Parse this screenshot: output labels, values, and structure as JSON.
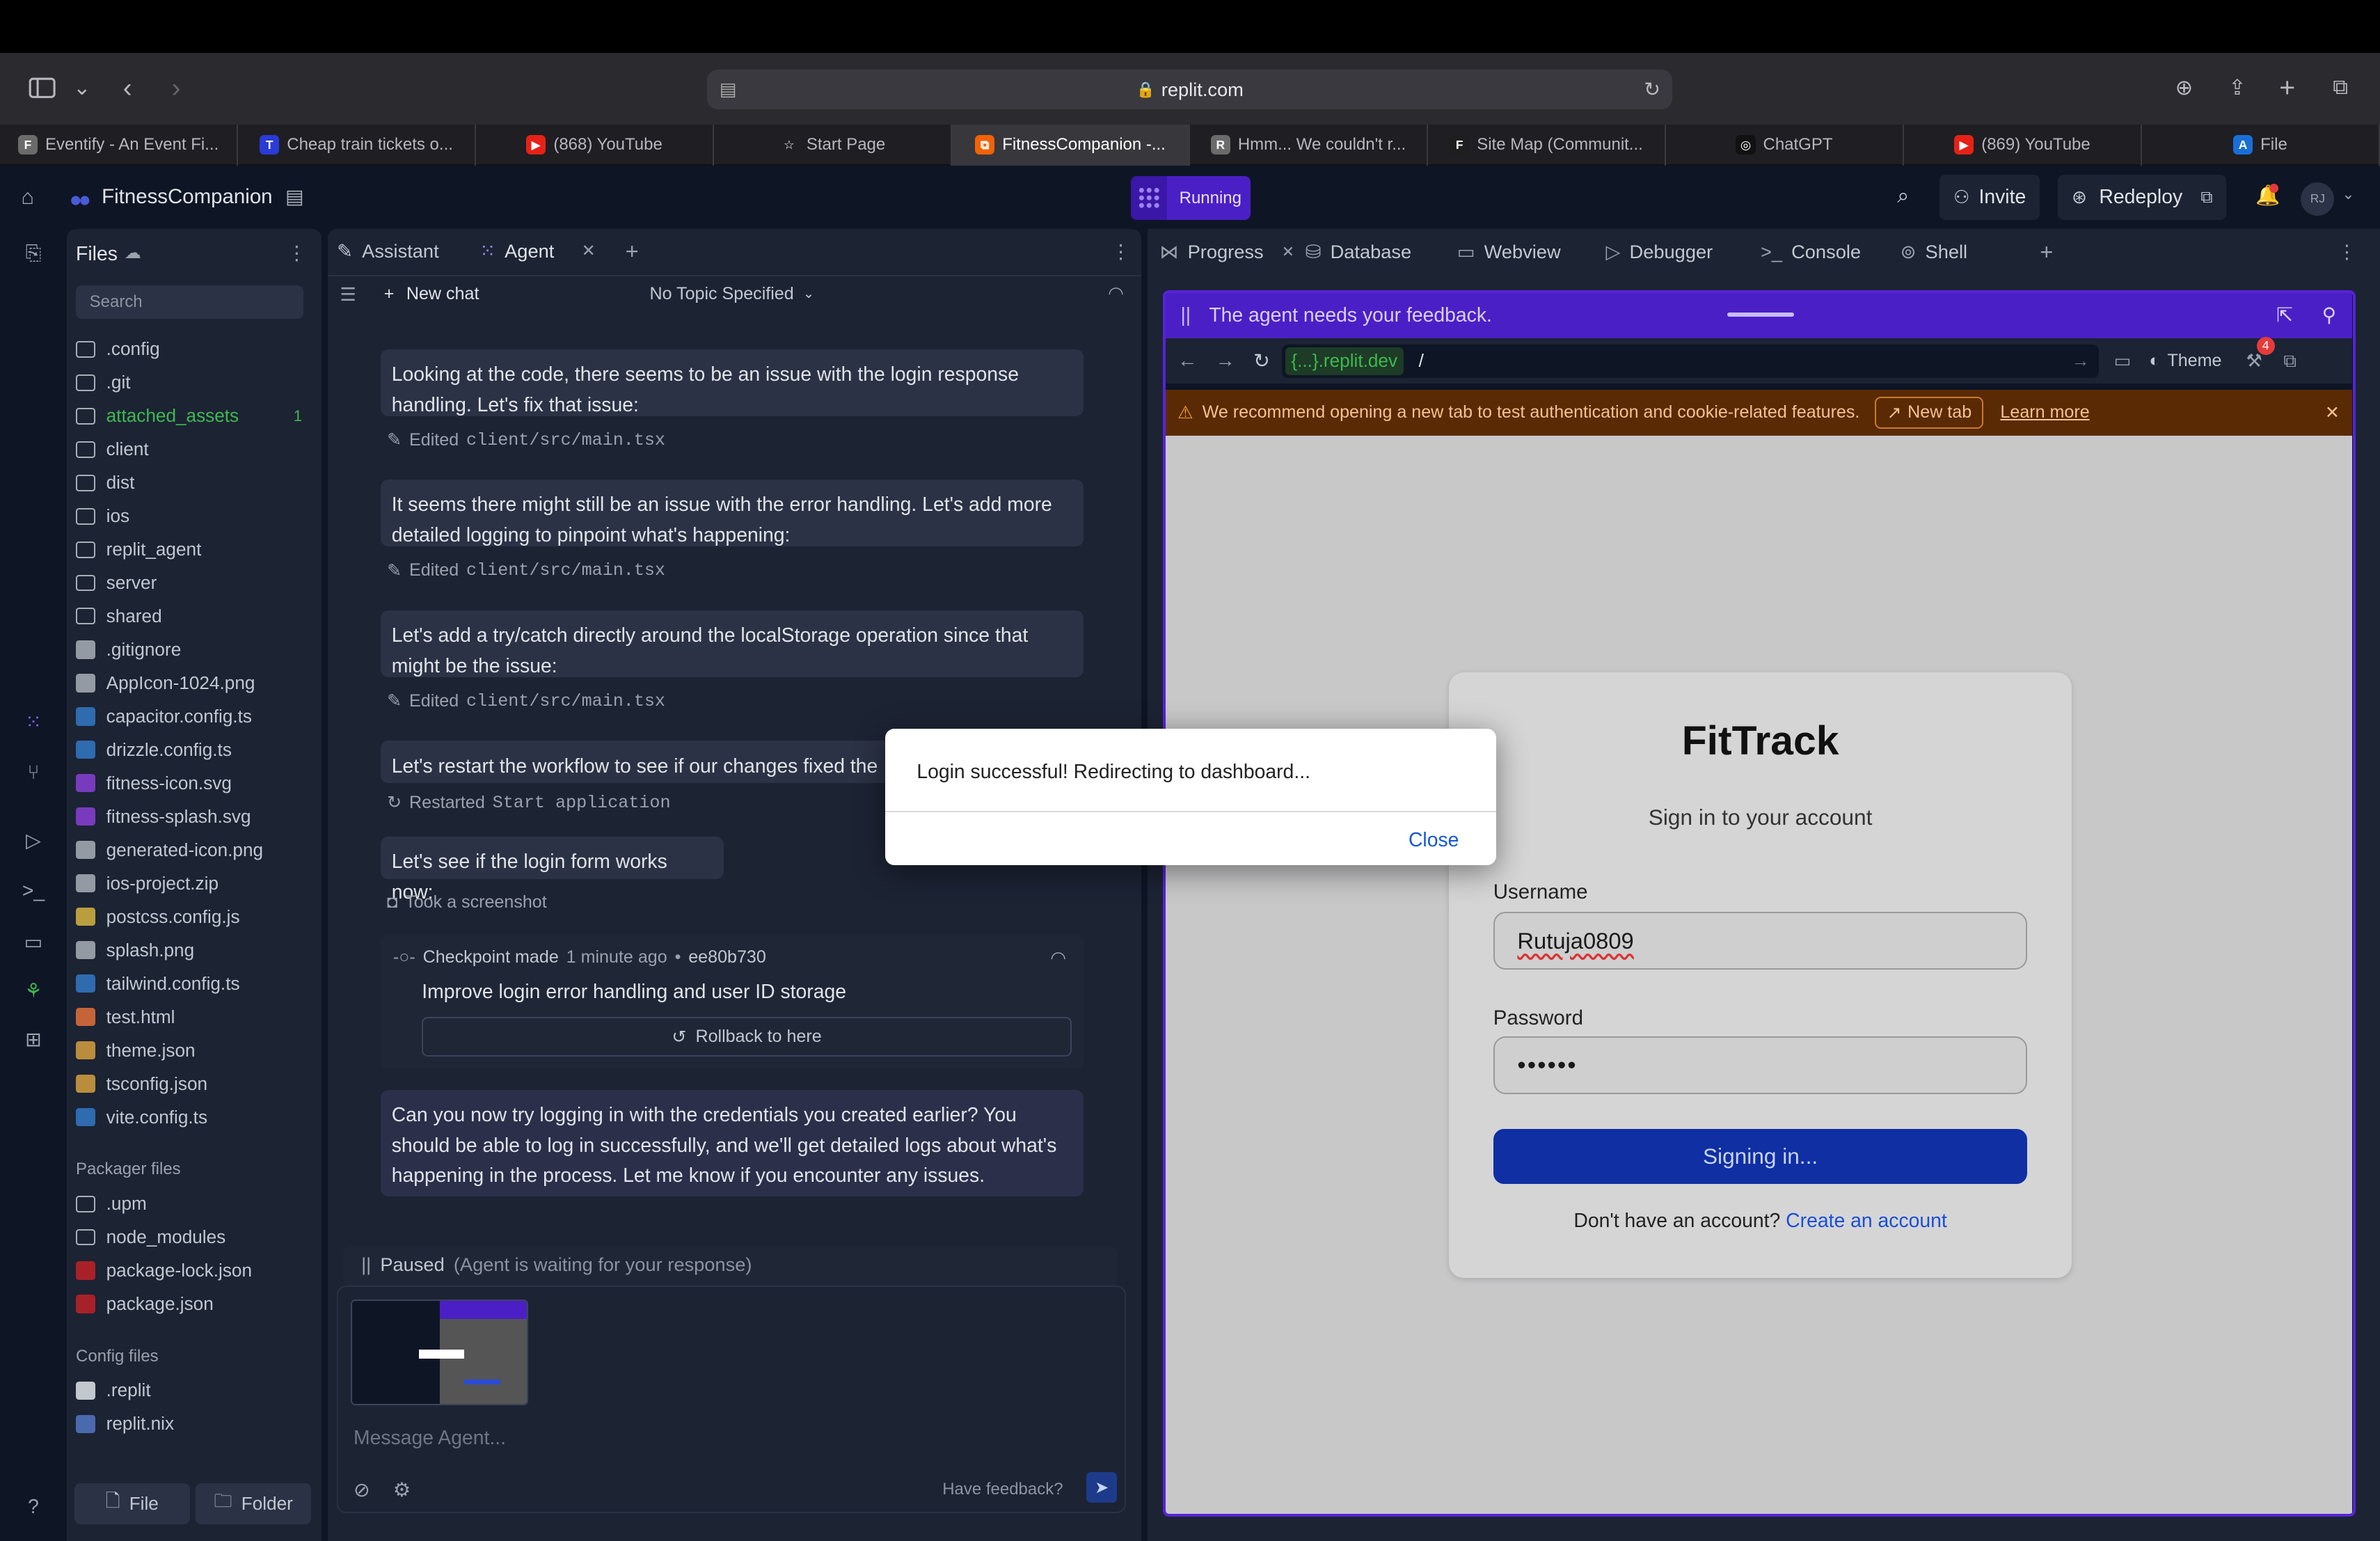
{
  "browser": {
    "url": "replit.com",
    "tabs": [
      {
        "label": "Eventify - An Event Fi...",
        "fav": "F",
        "color": "#6b6b6b"
      },
      {
        "label": "Cheap train tickets o...",
        "fav": "T",
        "color": "#2b3bd6"
      },
      {
        "label": "(868) YouTube",
        "fav": "▶",
        "color": "#e62117"
      },
      {
        "label": "Start Page",
        "fav": "☆",
        "color": "transparent"
      },
      {
        "label": "FitnessCompanion -...",
        "fav": "⧉",
        "color": "#f26207"
      },
      {
        "label": "Hmm... We couldn't r...",
        "fav": "R",
        "color": "#6b6b6b"
      },
      {
        "label": "Site Map (Communit...",
        "fav": "F",
        "color": "#1e1e1e"
      },
      {
        "label": "ChatGPT",
        "fav": "◎",
        "color": "#111"
      },
      {
        "label": "(869) YouTube",
        "fav": "▶",
        "color": "#e62117"
      },
      {
        "label": "File",
        "fav": "A",
        "color": "#1a6fd6"
      }
    ]
  },
  "header": {
    "project": "FitnessCompanion",
    "status": "Running",
    "invite": "Invite",
    "redeploy": "Redeploy",
    "avatar": "RJ"
  },
  "files": {
    "title": "Files",
    "search_placeholder": "Search",
    "items": [
      {
        "name": ".config",
        "type": "folder"
      },
      {
        "name": ".git",
        "type": "folder"
      },
      {
        "name": "attached_assets",
        "type": "folder",
        "badge": "1",
        "green": true
      },
      {
        "name": "client",
        "type": "folder"
      },
      {
        "name": "dist",
        "type": "folder"
      },
      {
        "name": "ios",
        "type": "folder"
      },
      {
        "name": "replit_agent",
        "type": "folder"
      },
      {
        "name": "server",
        "type": "folder"
      },
      {
        "name": "shared",
        "type": "folder"
      },
      {
        "name": ".gitignore",
        "type": "file"
      },
      {
        "name": "AppIcon-1024.png",
        "type": "image"
      },
      {
        "name": "capacitor.config.ts",
        "type": "ts"
      },
      {
        "name": "drizzle.config.ts",
        "type": "ts"
      },
      {
        "name": "fitness-icon.svg",
        "type": "svg"
      },
      {
        "name": "fitness-splash.svg",
        "type": "svg"
      },
      {
        "name": "generated-icon.png",
        "type": "image"
      },
      {
        "name": "ios-project.zip",
        "type": "zip"
      },
      {
        "name": "postcss.config.js",
        "type": "js"
      },
      {
        "name": "splash.png",
        "type": "image"
      },
      {
        "name": "tailwind.config.ts",
        "type": "ts"
      },
      {
        "name": "test.html",
        "type": "html"
      },
      {
        "name": "theme.json",
        "type": "json"
      },
      {
        "name": "tsconfig.json",
        "type": "json"
      },
      {
        "name": "vite.config.ts",
        "type": "ts"
      }
    ],
    "packager_title": "Packager files",
    "packager": [
      {
        "name": ".upm",
        "type": "folder"
      },
      {
        "name": "node_modules",
        "type": "folder"
      },
      {
        "name": "package-lock.json",
        "type": "npm"
      },
      {
        "name": "package.json",
        "type": "npm"
      }
    ],
    "config_title": "Config files",
    "config": [
      {
        "name": ".replit",
        "type": "replit"
      },
      {
        "name": "replit.nix",
        "type": "nix"
      }
    ],
    "new_file": "File",
    "new_folder": "Folder"
  },
  "agent": {
    "tab_assistant": "Assistant",
    "tab_agent": "Agent",
    "new_chat": "New chat",
    "topic": "No Topic Specified",
    "messages": [
      "Looking at the code, there seems to be an issue with the login response handling. Let's fix that issue:",
      "It seems there might still be an issue with the error handling. Let's add more detailed logging to pinpoint what's happening:",
      "Let's add a try/catch directly around the localStorage operation since that might be the issue:",
      "Let's restart the workflow to see if our changes fixed the",
      "Let's see if the login form works now:"
    ],
    "edited_label": "Edited",
    "edited_file": "client/src/main.tsx",
    "restarted_label": "Restarted",
    "restarted_target": "Start application",
    "screenshot_label": "Took a screenshot",
    "checkpoint_label": "Checkpoint made",
    "checkpoint_time": "1 minute ago",
    "checkpoint_hash": "ee80b730",
    "checkpoint_title": "Improve login error handling and user ID storage",
    "rollback": "Rollback to here",
    "final_message": "Can you now try logging in with the credentials you created earlier? You should be able to log in successfully, and we'll get detailed logs about what's happening in the process. Let me know if you encounter any issues.",
    "paused": "Paused",
    "paused_detail": "(Agent is waiting for your response)",
    "input_placeholder": "Message Agent...",
    "feedback": "Have feedback?"
  },
  "right": {
    "tabs": [
      "Progress",
      "Database",
      "Webview",
      "Debugger",
      "Console",
      "Shell"
    ],
    "feedback_banner": "The agent needs your feedback.",
    "url_host": "{...}.replit.dev",
    "url_path": "/",
    "theme": "Theme",
    "badge": "4",
    "warning": "We recommend opening a new tab to test authentication and cookie-related features.",
    "new_tab": "New tab",
    "learn_more": "Learn more"
  },
  "fittrack": {
    "title": "FitTrack",
    "subtitle": "Sign in to your account",
    "username_label": "Username",
    "username_value": "Rutuja0809",
    "password_label": "Password",
    "password_value": "••••••",
    "button": "Signing in...",
    "signup_prompt": "Don't have an account?",
    "signup_link": "Create an account"
  },
  "dialog": {
    "message": "Login successful! Redirecting to dashboard...",
    "close": "Close"
  },
  "colors": {
    "accent_purple": "#5524d6",
    "replit_bg": "#0e1525",
    "panel_bg": "#1c2333",
    "button_blue": "#0f2fa3",
    "link_blue": "#1a4fd6"
  }
}
